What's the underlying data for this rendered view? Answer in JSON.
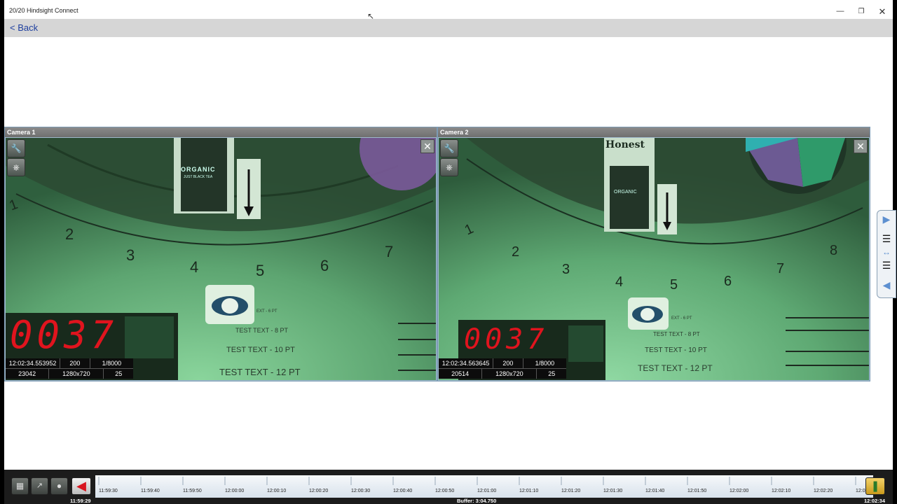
{
  "window": {
    "title": "20/20 Hindsight Connect"
  },
  "nav": {
    "back_label": "< Back"
  },
  "cameras": [
    {
      "name": "Camera 1",
      "overlay": {
        "timestamp": "12:02:34.553952",
        "shutter": "200",
        "exposure": "1/8000",
        "frame": "23042",
        "resolution": "1280x720",
        "fps": "25"
      },
      "counter": "0037",
      "scale_numbers": [
        "1",
        "2",
        "3",
        "4",
        "5",
        "6",
        "7"
      ],
      "product": "ORGANIC",
      "product_sub": "JUST BLACK TEA",
      "test_texts": [
        "EXT - 6 PT",
        "TEST TEXT - 8 PT",
        "TEST TEXT - 10 PT",
        "TEST TEXT - 12 PT"
      ]
    },
    {
      "name": "Camera 2",
      "overlay": {
        "timestamp": "12:02:34.563645",
        "shutter": "200",
        "exposure": "1/8000",
        "frame": "20514",
        "resolution": "1280x720",
        "fps": "25"
      },
      "counter": "0037",
      "scale_numbers": [
        "1",
        "2",
        "3",
        "4",
        "5",
        "6",
        "7",
        "8"
      ],
      "product": "Honest",
      "product_sub": "ORGANIC",
      "test_texts": [
        "EXT - 6 PT",
        "TEST TEXT - 8 PT",
        "TEST TEXT - 10 PT",
        "TEST TEXT - 12 PT"
      ]
    }
  ],
  "timeline": {
    "ticks": [
      "11:59:30",
      "11:59:40",
      "11:59:50",
      "12:00:00",
      "12:00:10",
      "12:00:20",
      "12:00:30",
      "12:00:40",
      "12:00:50",
      "12:01:00",
      "12:01:10",
      "12:01:20",
      "12:01:30",
      "12:01:40",
      "12:01:50",
      "12:02:00",
      "12:02:10",
      "12:02:20",
      "12:02:3"
    ],
    "start_label": "11:59:29",
    "buffer_label": "Buffer: 3:04.750",
    "end_label": "12:02:34"
  },
  "colors": {
    "accent": "#5c8fd0",
    "counter_red": "#e0141e",
    "feed_green": "#4c9363"
  }
}
